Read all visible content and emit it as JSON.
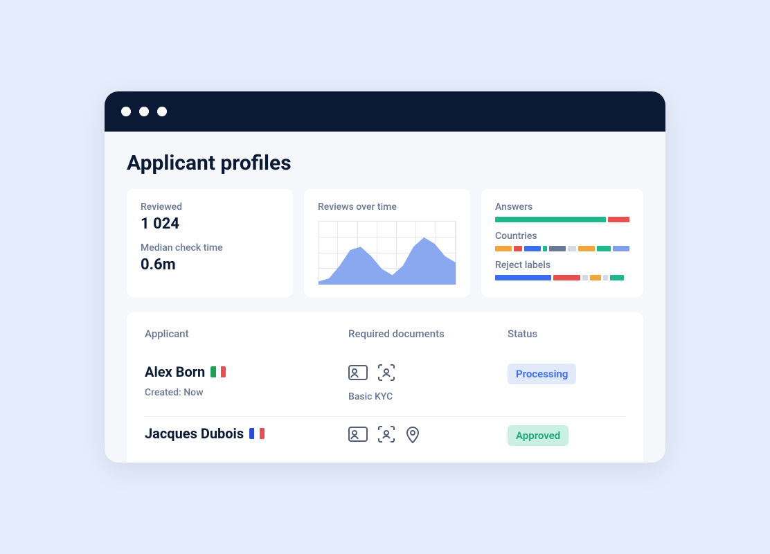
{
  "page": {
    "title": "Applicant profiles"
  },
  "stats": {
    "reviewed_label": "Reviewed",
    "reviewed_value": "1 024",
    "median_label": "Median check time",
    "median_value": "0.6m"
  },
  "chart": {
    "title": "Reviews over time"
  },
  "chart_data": {
    "type": "area",
    "title": "Reviews over time",
    "xlabel": "",
    "ylabel": "",
    "x": [
      0,
      1,
      2,
      3,
      4,
      5,
      6,
      7,
      8,
      9,
      10,
      11,
      12,
      13
    ],
    "values": [
      5,
      10,
      30,
      55,
      60,
      45,
      25,
      15,
      30,
      60,
      75,
      65,
      45,
      35
    ],
    "ylim": [
      0,
      100
    ]
  },
  "breakdowns": {
    "answers": {
      "label": "Answers",
      "segments": [
        {
          "color": "#1fb88a",
          "pct": 84
        },
        {
          "color": "#e94f4f",
          "pct": 16
        }
      ]
    },
    "countries": {
      "label": "Countries",
      "segments": [
        {
          "color": "#f2a63b",
          "pct": 14
        },
        {
          "color": "#e94f4f",
          "pct": 7
        },
        {
          "color": "#3a6df0",
          "pct": 14
        },
        {
          "color": "#1fb88a",
          "pct": 4
        },
        {
          "color": "#6a7896",
          "pct": 14
        },
        {
          "color": "#d6dae4",
          "pct": 7
        },
        {
          "color": "#f2a63b",
          "pct": 14
        },
        {
          "color": "#1fb88a",
          "pct": 12
        },
        {
          "color": "#7fa0e8",
          "pct": 14
        }
      ]
    },
    "reject_labels": {
      "label": "Reject labels",
      "segments": [
        {
          "color": "#3a6df0",
          "pct": 42
        },
        {
          "color": "#e94f4f",
          "pct": 20
        },
        {
          "color": "#d6dae4",
          "pct": 4
        },
        {
          "color": "#f2a63b",
          "pct": 8
        },
        {
          "color": "#d6dae4",
          "pct": 4
        },
        {
          "color": "#1fb88a",
          "pct": 10
        }
      ]
    }
  },
  "table": {
    "headers": {
      "applicant": "Applicant",
      "docs": "Required documents",
      "status": "Status"
    },
    "rows": [
      {
        "name": "Alex Born",
        "flag": {
          "name": "italy-flag",
          "colors": [
            "#1f9e55",
            "#ffffff",
            "#e94f4f"
          ]
        },
        "created_label": "Created: Now",
        "doc_icons": [
          "id-card-icon",
          "face-scan-icon"
        ],
        "doc_label": "Basic KYC",
        "status": {
          "text": "Processing",
          "class": "status-processing"
        }
      },
      {
        "name": "Jacques Dubois",
        "flag": {
          "name": "france-flag",
          "colors": [
            "#2a4bd7",
            "#ffffff",
            "#e94f4f"
          ]
        },
        "created_label": "",
        "doc_icons": [
          "id-card-icon",
          "face-scan-icon",
          "location-pin-icon"
        ],
        "doc_label": "",
        "status": {
          "text": "Approved",
          "class": "status-approved"
        }
      }
    ]
  },
  "colors": {
    "accent_blue": "#7fa0e8"
  }
}
